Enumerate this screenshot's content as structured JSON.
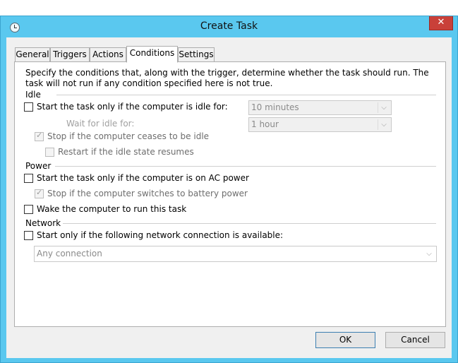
{
  "window": {
    "title": "Create Task",
    "close_label": "✕"
  },
  "tabs": [
    {
      "label": "General"
    },
    {
      "label": "Triggers"
    },
    {
      "label": "Actions"
    },
    {
      "label": "Conditions"
    },
    {
      "label": "Settings"
    }
  ],
  "active_tab": "Conditions",
  "intro": "Specify the conditions that, along with the trigger, determine whether the task should run.  The task will not run  if any condition specified here is not true.",
  "idle": {
    "group_label": "Idle",
    "start_if_idle": {
      "label": "Start the task only if the computer is idle for:",
      "checked": false
    },
    "idle_for_value": "10 minutes",
    "wait_label": "Wait for idle for:",
    "wait_value": "1 hour",
    "stop_if_ceases": {
      "label": "Stop if the computer ceases to be idle",
      "checked": true
    },
    "restart_if_resumes": {
      "label": "Restart if the idle state resumes",
      "checked": false
    }
  },
  "power": {
    "group_label": "Power",
    "ac_power": {
      "label": "Start the task only if the computer is on AC power",
      "checked": false
    },
    "battery_stop": {
      "label": "Stop if the computer switches to battery power",
      "checked": true
    },
    "wake": {
      "label": "Wake the computer to run this task",
      "checked": false
    }
  },
  "network": {
    "group_label": "Network",
    "start_if_network": {
      "label": "Start only if the following network connection is available:",
      "checked": false
    },
    "connection_value": "Any connection"
  },
  "buttons": {
    "ok": "OK",
    "cancel": "Cancel"
  },
  "colors": {
    "titlebar": "#5ac8ef",
    "close": "#c94039",
    "panel": "#ffffff",
    "client": "#f0f0f0"
  }
}
